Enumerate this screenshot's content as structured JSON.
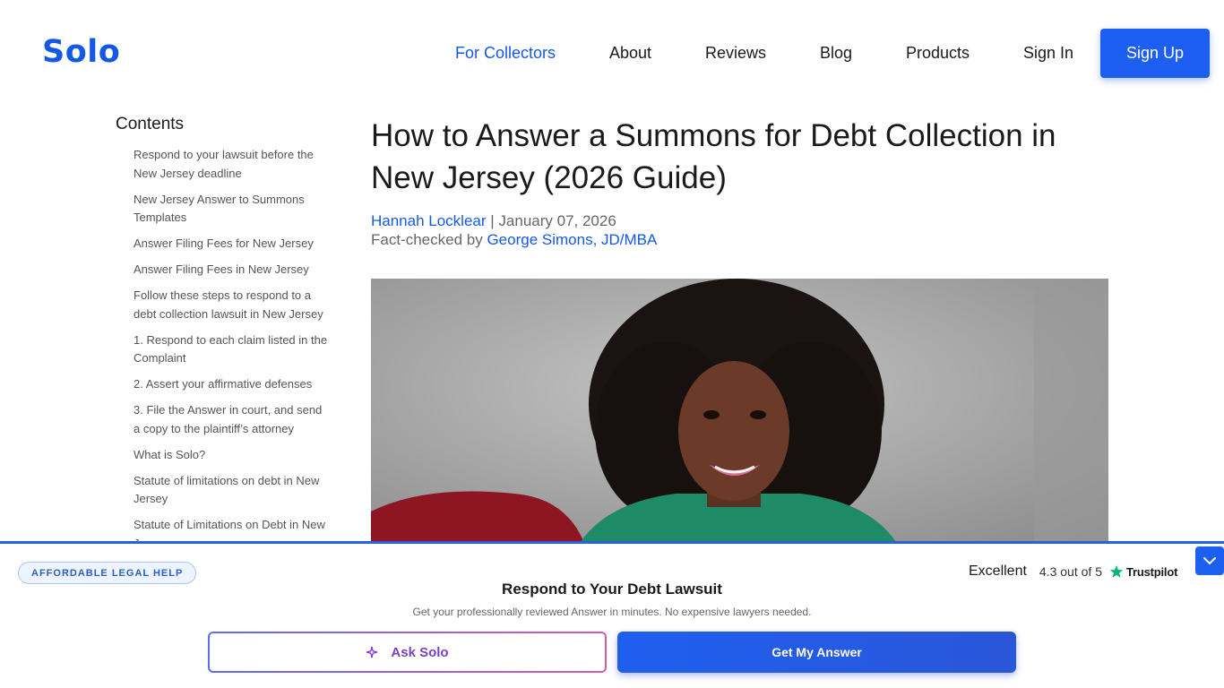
{
  "header": {
    "logo": "Solo",
    "nav": [
      {
        "label": "For Collectors"
      },
      {
        "label": "About"
      },
      {
        "label": "Reviews"
      },
      {
        "label": "Blog"
      },
      {
        "label": "Products"
      },
      {
        "label": "Sign In"
      }
    ],
    "signup_label": "Sign Up"
  },
  "colors": {
    "brand_blue": "#1459e6",
    "text": "#1a1a1a",
    "muted": "#666666"
  },
  "sidebar": {
    "title": "Contents",
    "items": [
      {
        "label": "Respond to your lawsuit before the New Jersey deadline"
      },
      {
        "label": "New Jersey Answer to Summons Templates"
      },
      {
        "label": "Answer Filing Fees for New Jersey"
      },
      {
        "label": "Answer Filing Fees in New Jersey"
      },
      {
        "label": "Follow these steps to respond to a debt collection lawsuit in New Jersey"
      },
      {
        "label": "1. Respond to each claim listed in the Complaint"
      },
      {
        "label": "2. Assert your affirmative defenses"
      },
      {
        "label": "3. File the Answer in court, and send a copy to the plaintiff’s attorney"
      },
      {
        "label": "What is Solo?"
      },
      {
        "label": "Statute of limitations on debt in New Jersey"
      },
      {
        "label": "Statute of Limitations on Debt in New Jersey"
      }
    ]
  },
  "article": {
    "title": "How to Answer a Summons for Debt Collection in New Jersey (2026 Guide)",
    "author": "Hannah Locklear",
    "separator": " | ",
    "date": "January 07, 2026",
    "fact_checked_prefix": "Fact-checked by ",
    "fact_checker": "George Simons, JD/MBA"
  },
  "cta": {
    "badge": "AFFORDABLE LEGAL HELP",
    "trust_label": "Excellent",
    "trust_score": "4.3 out of 5",
    "trust_brand": "Trustpilot",
    "title": "Respond to Your Debt Lawsuit",
    "subtitle": "Get your professionally reviewed Answer in minutes. No expensive lawyers needed.",
    "ask_label": "Ask Solo",
    "answer_label": "Get My Answer"
  }
}
